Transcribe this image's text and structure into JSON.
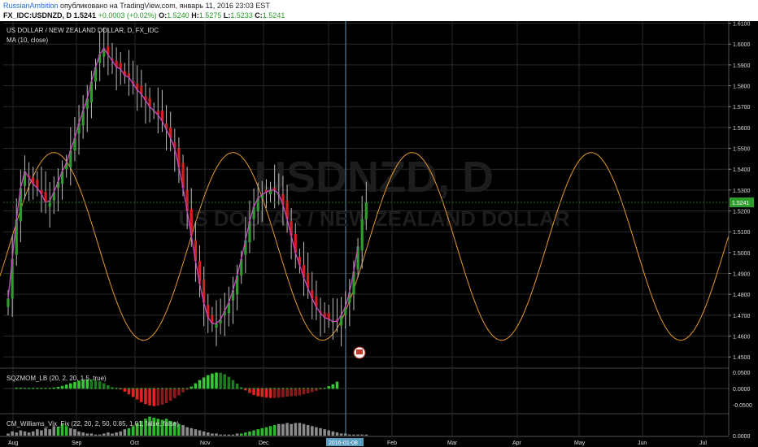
{
  "header": {
    "user": "RussianAmbition",
    "published": "опубликовано на TradingView.com, январь 11, 2016 23:03 EST",
    "symbol": "FX_IDC:USDNZD, D",
    "last": "1.5241",
    "change": "+0.0003 (+0.02%)",
    "o_label": "O:",
    "o_value": "1.5240",
    "h_label": "H:",
    "h_value": "1.5275",
    "l_label": "L:",
    "l_value": "1.5233",
    "c_label": "C:",
    "c_value": "1.5241"
  },
  "chart_data": {
    "type": "candlestick",
    "title": "US DOLLAR / NEW ZEALAND DOLLAR, D, FX_IDC",
    "indicator_label": "MA (10, close)",
    "watermark_symbol": "USDNZD, D",
    "watermark_name": "US DOLLAR / NEW ZEALAND DOLLAR",
    "price_ticks": [
      "1.6100",
      "1.6000",
      "1.5900",
      "1.5800",
      "1.5700",
      "1.5600",
      "1.5500",
      "1.5400",
      "1.5300",
      "1.5200",
      "1.5100",
      "1.5000",
      "1.4900",
      "1.4800",
      "1.4700",
      "1.4600",
      "1.4500"
    ],
    "ylim": [
      1.445,
      1.611
    ],
    "last_price": "1.5241",
    "x_labels": [
      "Aug",
      "Sep",
      "Oct",
      "Nov",
      "Dec",
      "2016-01-08",
      "Feb",
      "Mar",
      "Apr",
      "May",
      "Jun",
      "Jul"
    ],
    "cursor_date": "2016-01-08",
    "closes": [
      1.478,
      1.497,
      1.516,
      1.531,
      1.539,
      1.536,
      1.533,
      1.531,
      1.528,
      1.524,
      1.525,
      1.529,
      1.534,
      1.539,
      1.543,
      1.549,
      1.555,
      1.562,
      1.568,
      1.574,
      1.582,
      1.589,
      1.595,
      1.598,
      1.595,
      1.592,
      1.589,
      1.588,
      1.585,
      1.584,
      1.581,
      1.578,
      1.576,
      1.573,
      1.57,
      1.568,
      1.566,
      1.563,
      1.559,
      1.555,
      1.55,
      1.541,
      1.531,
      1.52,
      1.508,
      1.496,
      1.485,
      1.476,
      1.469,
      1.466,
      1.466,
      1.468,
      1.472,
      1.476,
      1.482,
      1.489,
      1.497,
      1.506,
      1.515,
      1.522,
      1.526,
      1.528,
      1.529,
      1.53,
      1.53,
      1.528,
      1.523,
      1.516,
      1.508,
      1.5,
      1.494,
      1.488,
      1.483,
      1.478,
      1.474,
      1.471,
      1.469,
      1.468,
      1.467,
      1.467,
      1.47,
      1.474,
      1.481,
      1.491,
      1.503,
      1.516,
      1.524
    ],
    "ma": [
      1.478,
      1.497,
      1.516,
      1.531,
      1.539,
      1.536,
      1.533,
      1.531,
      1.528,
      1.524,
      1.525,
      1.529,
      1.534,
      1.539,
      1.543,
      1.549,
      1.555,
      1.562,
      1.568,
      1.574,
      1.582,
      1.589,
      1.595,
      1.598,
      1.595,
      1.592,
      1.589,
      1.588,
      1.585,
      1.584,
      1.581,
      1.578,
      1.576,
      1.573,
      1.57,
      1.568,
      1.566,
      1.563,
      1.559,
      1.555,
      1.55,
      1.541,
      1.531,
      1.52,
      1.508,
      1.496,
      1.485,
      1.476,
      1.469,
      1.466,
      1.466,
      1.468,
      1.472,
      1.476,
      1.482,
      1.489,
      1.497,
      1.506,
      1.515,
      1.522,
      1.526,
      1.528,
      1.529,
      1.53,
      1.53,
      1.528,
      1.523,
      1.516,
      1.508,
      1.5,
      1.494,
      1.488,
      1.483,
      1.478,
      1.474,
      1.471,
      1.469,
      1.468,
      1.467,
      1.467,
      1.47,
      1.474,
      1.481,
      1.491,
      1.503
    ],
    "cycle": {
      "min": 1.458,
      "max": 1.548,
      "first_peak_index": 11,
      "period_bars": 43
    },
    "panel2": {
      "label": "SQZMOM_LB (20, 2, 20, 1.5, true)",
      "ticks": [
        "0.0500",
        "0.0000",
        "-0.0500"
      ],
      "ylim": [
        -0.075,
        0.06
      ],
      "values": [
        0.003,
        0.003,
        0.002,
        0.002,
        0.002,
        0.002,
        0.002,
        0.002,
        0.002,
        0.003,
        0.005,
        0.008,
        0.012,
        0.016,
        0.02,
        0.024,
        0.027,
        0.028,
        0.028,
        0.026,
        0.022,
        0.016,
        0.01,
        0.004,
        0.002,
        -0.003,
        -0.01,
        -0.018,
        -0.026,
        -0.034,
        -0.042,
        -0.048,
        -0.052,
        -0.054,
        -0.053,
        -0.05,
        -0.045,
        -0.038,
        -0.03,
        -0.021,
        -0.012,
        -0.004,
        0.006,
        0.016,
        0.026,
        0.034,
        0.041,
        0.046,
        0.049,
        0.048,
        0.044,
        0.036,
        0.026,
        0.015,
        0.004,
        -0.006,
        -0.014,
        -0.02,
        -0.024,
        -0.026,
        -0.028,
        -0.029,
        -0.029,
        -0.028,
        -0.027,
        -0.025,
        -0.024,
        -0.023,
        -0.021,
        -0.018,
        -0.015,
        -0.011,
        -0.007,
        -0.003,
        0.002,
        0.007,
        0.013,
        0.021
      ]
    },
    "panel3": {
      "label": "CM_Williams_Vix_Fix (22, 20, 2, 50, 0.85, 1.01, false, false)",
      "ticks": [
        "0.0000"
      ],
      "ylim": [
        0,
        0.02
      ],
      "values": [
        0.002,
        0.004,
        0.003,
        0.005,
        0.004,
        0.003,
        0.004,
        0.006,
        0.005,
        0.007,
        0.006,
        0.009,
        0.008,
        0.011,
        0.009,
        0.007,
        0.006,
        0.004,
        0.003,
        0.002,
        0.002,
        0.001,
        0.001,
        0.002,
        0.003,
        0.002,
        0.003,
        0.004,
        0.006,
        0.007,
        0.009,
        0.012,
        0.014,
        0.016,
        0.018,
        0.017,
        0.016,
        0.015,
        0.016,
        0.014,
        0.013,
        0.011,
        0.01,
        0.008,
        0.007,
        0.006,
        0.005,
        0.004,
        0.003,
        0.002,
        0.002,
        0.001,
        0.001,
        0.001,
        0.001,
        0.002,
        0.002,
        0.003,
        0.004,
        0.005,
        0.006,
        0.007,
        0.008,
        0.009,
        0.01,
        0.011,
        0.011,
        0.012,
        0.011,
        0.012,
        0.012,
        0.011,
        0.01,
        0.009,
        0.008,
        0.007,
        0.006,
        0.005,
        0.004,
        0.003,
        0.002,
        0.002,
        0.001,
        0.001,
        0.001,
        0.001,
        0.001
      ],
      "green_bar_indices": [
        12,
        13,
        14,
        29,
        30,
        31,
        32,
        33,
        34,
        35,
        36,
        37,
        38,
        39,
        40,
        41,
        56,
        57,
        58,
        59,
        60,
        61,
        62,
        63,
        64
      ]
    }
  },
  "colors": {
    "bull": "#2e9d2e",
    "bear": "#d42020",
    "ma": "#c84bc8",
    "cycle": "#e59a2a",
    "grid": "#2a2a2a",
    "text": "#dddddd",
    "last_price_bg": "#2e9d2e"
  }
}
